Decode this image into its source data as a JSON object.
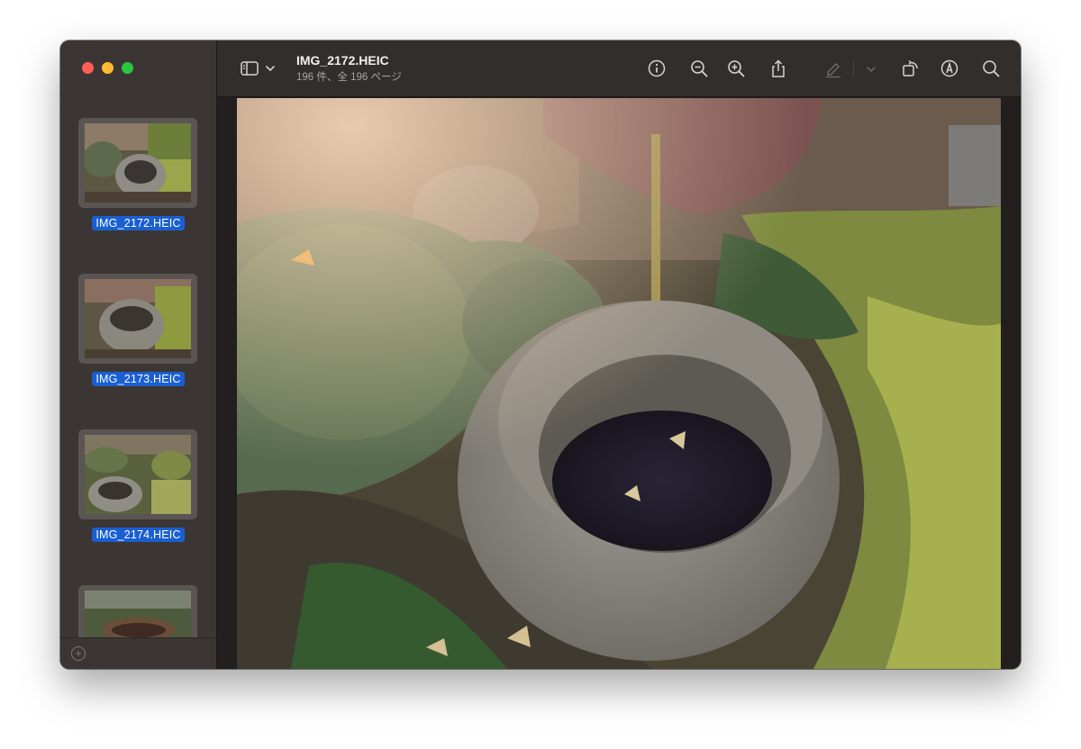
{
  "window": {
    "title": "IMG_2172.HEIC",
    "subtitle": "196 件、全 196 ページ"
  },
  "sidebar": {
    "thumbnails": [
      {
        "label": "IMG_2172.HEIC",
        "selected": true
      },
      {
        "label": "IMG_2173.HEIC",
        "selected": true
      },
      {
        "label": "IMG_2174.HEIC",
        "selected": true
      },
      {
        "label": "",
        "selected": false
      }
    ]
  },
  "toolbar": {
    "icons": [
      "sidebar-toggle-icon",
      "chevron-down-icon",
      "info-icon",
      "zoom-out-icon",
      "zoom-in-icon",
      "share-icon",
      "markup-pen-icon",
      "chevron-down-icon",
      "rotate-icon",
      "annotate-icon",
      "search-icon"
    ]
  },
  "colors": {
    "selection": "#1a5fd1",
    "close": "#fe5f57",
    "minimize": "#febc2e",
    "maximize": "#28c840"
  }
}
